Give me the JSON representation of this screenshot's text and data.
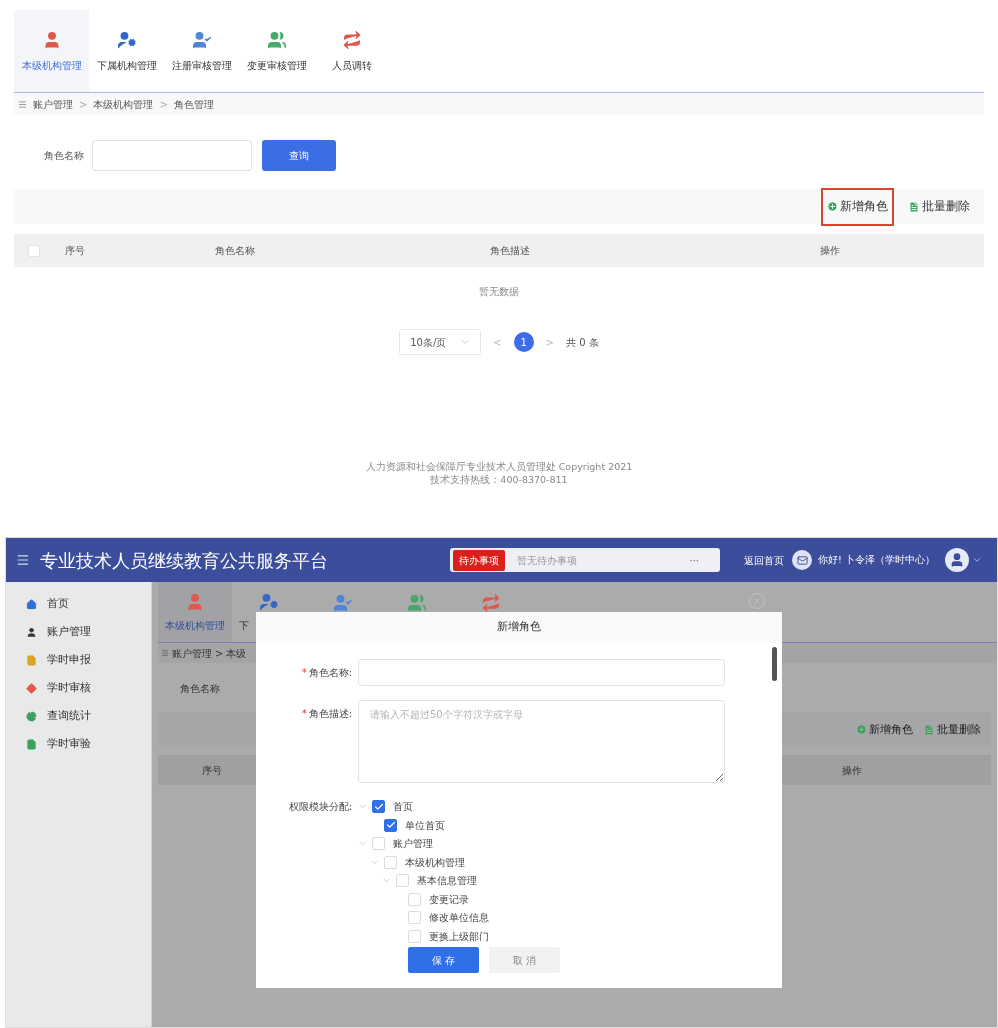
{
  "role_page": {
    "tabs": [
      {
        "label": "本级机构管理",
        "selected": true,
        "color": "#e0584c"
      },
      {
        "label": "下属机构管理",
        "selected": false,
        "color": "#3567c8"
      },
      {
        "label": "注册审核管理",
        "selected": false,
        "color": "#4f86d8"
      },
      {
        "label": "变更审核管理",
        "selected": false,
        "color": "#48a86a"
      },
      {
        "label": "人员调转",
        "selected": false,
        "color": "#e0584c"
      }
    ],
    "breadcrumb": [
      "账户管理",
      "本级机构管理",
      "角色管理"
    ],
    "breadcrumb_separator": ">",
    "search": {
      "label": "角色名称",
      "button": "查询"
    },
    "actions": [
      {
        "label": "新增角色",
        "highlighted": true
      },
      {
        "label": "批量删除",
        "highlighted": false
      }
    ],
    "select_all": {
      "checked": false
    },
    "columns": [
      "序号",
      "角色名称",
      "角色描述",
      "操作"
    ],
    "empty_text": "暂无数据",
    "pagination": {
      "page_size": "10条/页",
      "prev": "<",
      "page": "1",
      "next": ">",
      "total": "共 0 条"
    },
    "footer": [
      "人力资源和社会保障厅专业技术人员管理处 Copyright 2021",
      "技术支持热线：400-8370-811"
    ]
  },
  "app": {
    "title": "专业技术人员继续教育公共服务平台",
    "todo": {
      "badge": "待办事项",
      "text": "暂无待办事项",
      "more": "···"
    },
    "home_link": "返回首页",
    "greeting": "你好! 卜令泽（学时中心）",
    "sidebar": [
      {
        "label": "首页",
        "color": "#2f6fdc"
      },
      {
        "label": "账户管理",
        "color": "#333333"
      },
      {
        "label": "学时申报",
        "color": "#d9a520"
      },
      {
        "label": "学时审核",
        "color": "#e05a4a"
      },
      {
        "label": "查询统计",
        "color": "#3aa35c"
      },
      {
        "label": "学时审验",
        "color": "#3aa35c"
      }
    ],
    "background": {
      "tab_labels": [
        "本级机构管理",
        "下"
      ],
      "breadcrumb": [
        "账户管理",
        ">",
        "本级"
      ],
      "search_label": "角色名称",
      "actions": [
        "新增角色",
        "批量删除"
      ],
      "columns": [
        "序号",
        "操作"
      ]
    },
    "dialog": {
      "title": "新增角色",
      "fields": [
        {
          "label": "角色名称:",
          "required_mark": "*",
          "kind": "input"
        },
        {
          "label": "角色描述:",
          "required_mark": "*",
          "kind": "textarea",
          "placeholder": "请输入不超过50个字符汉字或字母"
        }
      ],
      "tree_label": "权限模块分配:",
      "tree": [
        {
          "label": "首页",
          "checked": true,
          "expanded": true,
          "children": [
            {
              "label": "单位首页",
              "checked": true
            }
          ]
        },
        {
          "label": "账户管理",
          "checked": false,
          "expanded": true,
          "children": [
            {
              "label": "本级机构管理",
              "checked": false,
              "expanded": true,
              "children": [
                {
                  "label": "基本信息管理",
                  "checked": false,
                  "expanded": true,
                  "children": [
                    {
                      "label": "变更记录",
                      "checked": false
                    },
                    {
                      "label": "修改单位信息",
                      "checked": false
                    },
                    {
                      "label": "更换上级部门",
                      "checked": false
                    }
                  ]
                }
              ]
            }
          ]
        }
      ],
      "buttons": [
        {
          "label": "保 存",
          "kind": "primary"
        },
        {
          "label": "取 消",
          "kind": "secondary"
        }
      ]
    }
  }
}
